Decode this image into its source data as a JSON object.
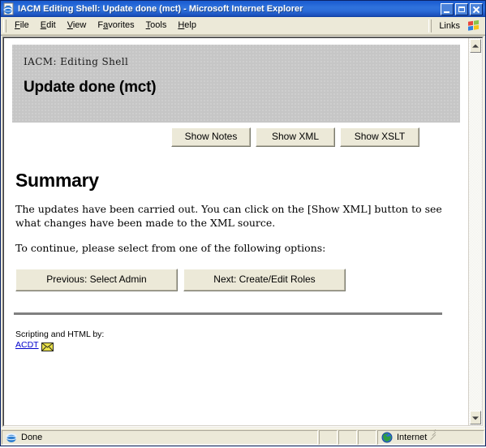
{
  "window": {
    "title": "IACM Editing Shell: Update done (mct) - Microsoft Internet Explorer",
    "icon": "ie-document-icon",
    "caption_buttons": [
      {
        "name": "minimize",
        "label": "Minimize"
      },
      {
        "name": "maximize",
        "label": "Maximize"
      },
      {
        "name": "close",
        "label": "Close"
      }
    ]
  },
  "menubar": {
    "items": [
      {
        "label": "File",
        "accel": "F"
      },
      {
        "label": "Edit",
        "accel": "E"
      },
      {
        "label": "View",
        "accel": "V"
      },
      {
        "label": "Favorites",
        "accel": "a"
      },
      {
        "label": "Tools",
        "accel": "T"
      },
      {
        "label": "Help",
        "accel": "H"
      }
    ],
    "links_label": "Links",
    "logo": "windows-flag-logo"
  },
  "page": {
    "header_panel": {
      "subtitle": "IACM: Editing Shell",
      "title": "Update done (mct)",
      "background_color": "#c6c6c6"
    },
    "action_buttons": [
      {
        "label": "Show Notes",
        "name": "show-notes"
      },
      {
        "label": "Show XML",
        "name": "show-xml"
      },
      {
        "label": "Show XSLT",
        "name": "show-xslt"
      }
    ],
    "summary_heading": "Summary",
    "paragraphs": [
      "The updates have been carried out. You can click on the [Show XML] button to see what changes have been made to the XML source.",
      "To continue, please select from one of the following options:"
    ],
    "nav_buttons": [
      {
        "label": "Previous: Select Admin",
        "name": "previous-select-admin"
      },
      {
        "label": "Next: Create/Edit Roles",
        "name": "next-create-edit-roles"
      }
    ],
    "footer": {
      "credit": "Scripting and HTML by:",
      "link_text": "ACDT",
      "link_color": "#0000cc",
      "mail_icon": "envelope-icon"
    }
  },
  "scrollbar": {
    "up_arrow": "scroll-up-arrow",
    "down_arrow": "scroll-down-arrow"
  },
  "statusbar": {
    "status_text": "Done",
    "status_icon": "ie-icon",
    "zone_text": "Internet",
    "zone_icon": "globe-icon"
  }
}
